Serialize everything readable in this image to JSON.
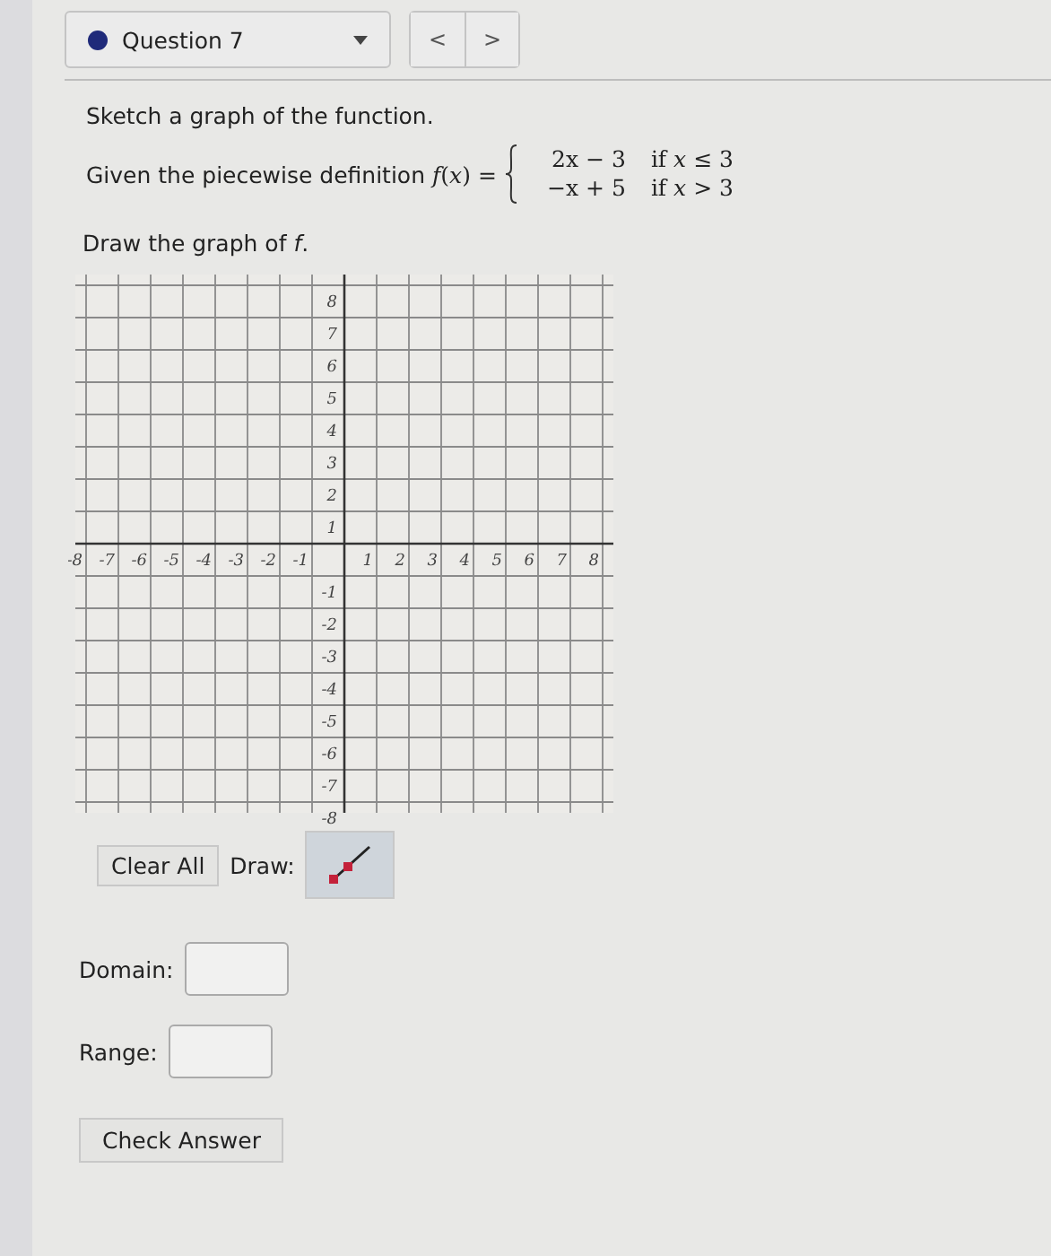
{
  "question": {
    "label": "Question 7"
  },
  "nav": [
    "<",
    ">"
  ],
  "prompt": "Sketch a graph of the function.",
  "given": {
    "prefix": "Given the piecewise definition",
    "lhs": "*f*(*x*) =",
    "cases": [
      {
        "expr": "2x − 3",
        "cond": "if  *x* ≤ 3"
      },
      {
        "expr": "−x + 5",
        "cond": "if  *x* > 3"
      }
    ]
  },
  "instruction": "Draw the graph of *f*.",
  "graph": {
    "xticks": [
      "-8",
      "-7",
      "-6",
      "-5",
      "-4",
      "-3",
      "-2",
      "-1",
      "1",
      "2",
      "3",
      "4",
      "5",
      "6",
      "7",
      "8"
    ],
    "yticks": [
      "8",
      "7",
      "6",
      "5",
      "4",
      "3",
      "2",
      "1",
      "-1",
      "-2",
      "-3",
      "-4",
      "-5",
      "-6",
      "-7",
      "-8"
    ]
  },
  "tools": {
    "clear": "Clear All",
    "draw_label": "Draw:",
    "draw_tool": {
      "selected": true
    }
  },
  "fields": [
    {
      "label": "Domain:"
    },
    {
      "label": "Range:"
    }
  ],
  "submit": "Check Answer"
}
